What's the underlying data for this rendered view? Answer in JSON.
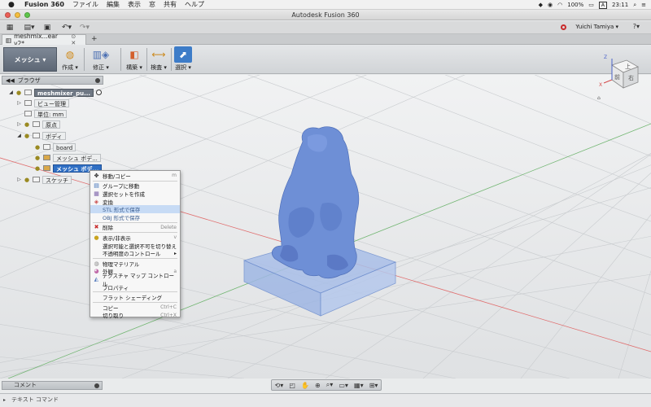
{
  "menubar": {
    "app_name": "Fusion 360",
    "items": [
      "ファイル",
      "編集",
      "表示",
      "窓",
      "共有",
      "ヘルプ"
    ],
    "battery": "100%",
    "input_mode": "A",
    "clock": "23:11"
  },
  "window": {
    "title": "Autodesk Fusion 360"
  },
  "qat": {
    "user": "Yuichi Tamiya ▾"
  },
  "tab": {
    "name": "meshmix...ear v2*"
  },
  "toolbar": {
    "workspace": "メッシュ ▾",
    "groups": [
      {
        "label": "作成 ▾"
      },
      {
        "label": "修正 ▾"
      },
      {
        "label": "構築 ▾"
      },
      {
        "label": "検査 ▾"
      },
      {
        "label": "選択 ▾"
      }
    ]
  },
  "browser": {
    "title": "ブラウザ",
    "nodes": [
      {
        "label": "meshmixer_pu..."
      },
      {
        "label": "ビュー管理"
      },
      {
        "label": "単位: mm"
      },
      {
        "label": "原点"
      },
      {
        "label": "ボディ"
      },
      {
        "label": "board"
      },
      {
        "label": "メッシュ ボデ..."
      },
      {
        "label": "メッシュ ボデ..."
      },
      {
        "label": "スケッチ"
      }
    ]
  },
  "context_menu": {
    "items": [
      {
        "label": "移動/コピー",
        "shortcut": "m"
      },
      {
        "label": "グループに移動",
        "shortcut": ""
      },
      {
        "label": "選択セットを作成",
        "shortcut": ""
      },
      {
        "label": "変換",
        "shortcut": ""
      },
      {
        "label": "STL 形式で保存",
        "shortcut": ""
      },
      {
        "label": "OBJ 形式で保存",
        "shortcut": ""
      },
      {
        "label": "削除",
        "shortcut": "Delete"
      },
      {
        "label": "表示/非表示",
        "shortcut": "v"
      },
      {
        "label": "選択可能と選択不可を切り替え",
        "shortcut": ""
      },
      {
        "label": "不透明度のコントロール",
        "shortcut": ""
      },
      {
        "label": "物理マテリアル",
        "shortcut": ""
      },
      {
        "label": "外観",
        "shortcut": "a"
      },
      {
        "label": "テクスチャ マップ コントロール",
        "shortcut": ""
      },
      {
        "label": "プロパティ",
        "shortcut": ""
      },
      {
        "label": "フラット シェーディング",
        "shortcut": ""
      },
      {
        "label": "コピー",
        "shortcut": "Ctrl+C"
      },
      {
        "label": "切り取り",
        "shortcut": "Ctrl+X"
      }
    ]
  },
  "viewcube": {
    "top": "上",
    "front": "前",
    "right": "右",
    "axis_x": "X",
    "axis_z": "Z"
  },
  "comments": {
    "label": "コメント"
  },
  "command_line": {
    "label": "テキスト コマンド"
  },
  "colors": {
    "selection": "#2f6fc4",
    "mesh_body": "#6e8fd6",
    "board": "#9fb4e0"
  }
}
